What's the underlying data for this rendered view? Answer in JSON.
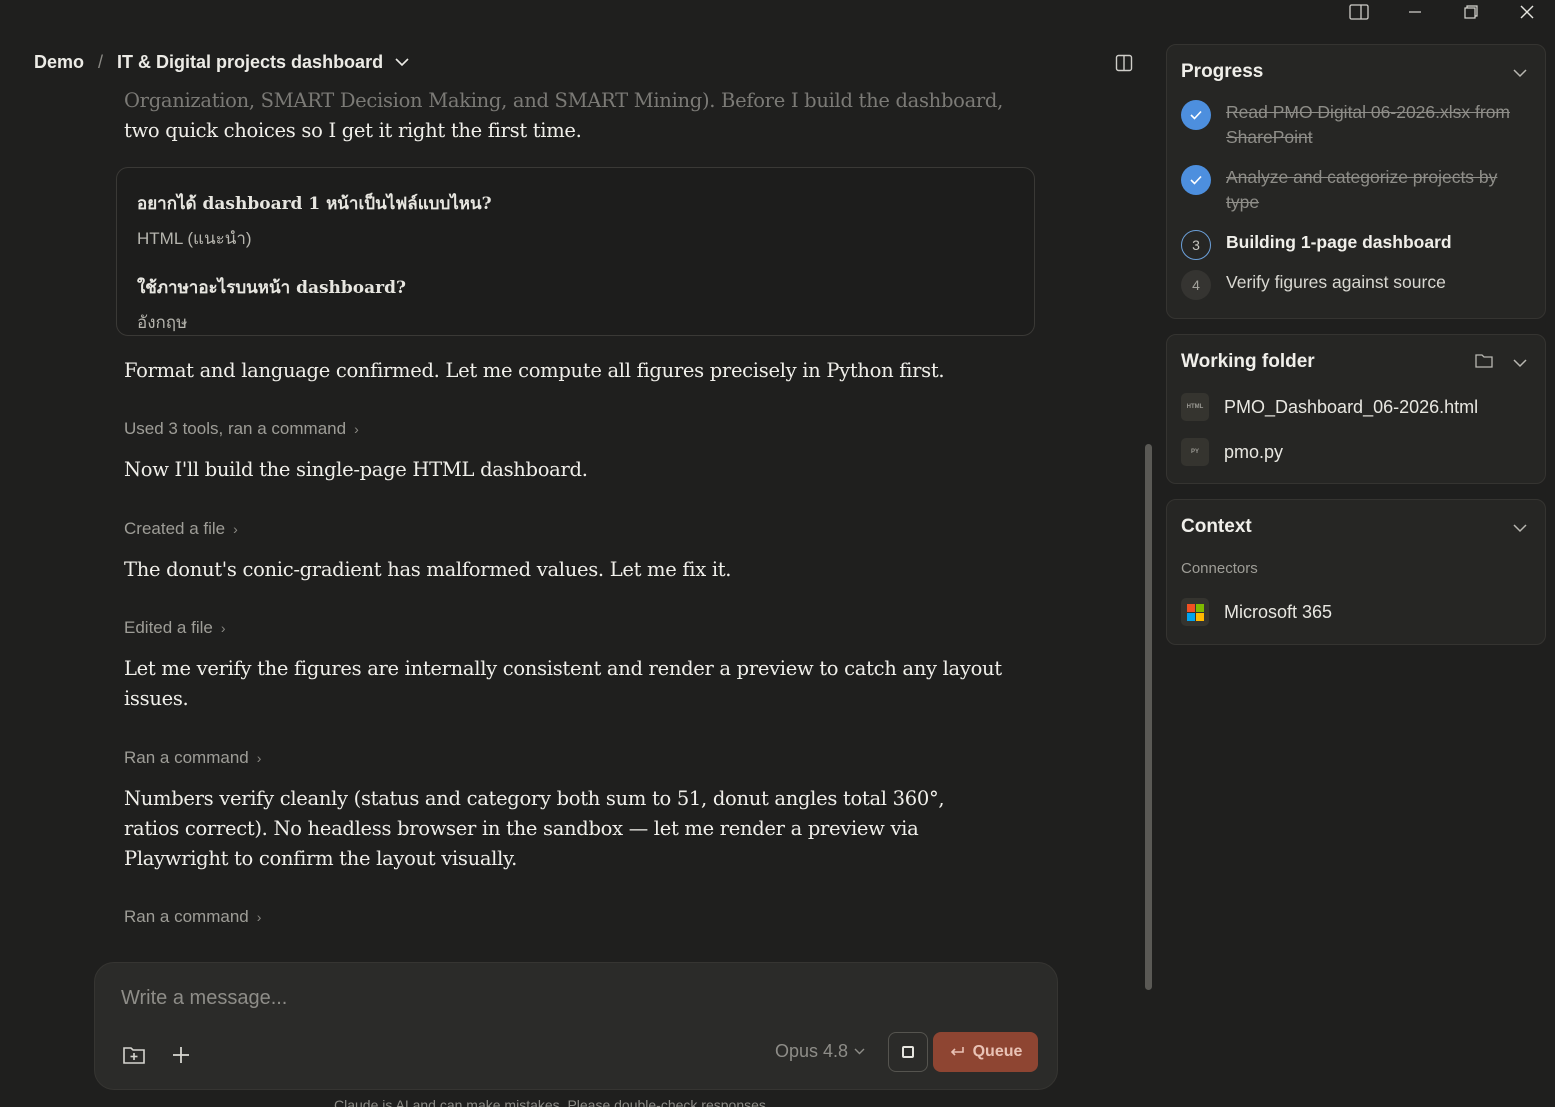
{
  "header": {
    "workspace": "Demo",
    "separator": "/",
    "project_title": "IT & Digital projects dashboard"
  },
  "chat": {
    "faded_line": "Organization, SMART Decision Making, and SMART Mining). Before I build the dashboard,",
    "intro_line": "two quick choices so I get it right the first time.",
    "questions": [
      {
        "question": "อยากได้ dashboard 1 หน้าเป็นไฟล์แบบไหน?",
        "answer": "HTML (แนะนำ)"
      },
      {
        "question": "ใช้ภาษาอะไรบนหน้า dashboard?",
        "answer": "อังกฤษ"
      }
    ],
    "msg_format_confirmed": "Format and language confirmed. Let me compute all figures precisely in Python first.",
    "tool_used_3": "Used 3 tools, ran a command",
    "msg_build": "Now I'll build the single-page HTML dashboard.",
    "tool_created": "Created a file",
    "msg_donut": "The donut's conic-gradient has malformed values. Let me fix it.",
    "tool_edited": "Edited a file",
    "msg_verify": "Let me verify the figures are internally consistent and render a preview to catch any layout issues.",
    "tool_ran_1": "Ran a command",
    "msg_numbers": "Numbers verify cleanly (status and category both sum to 51, donut angles total 360°, ratios correct). No headless browser in the sandbox — let me render a preview via Playwright to confirm the layout visually.",
    "tool_ran_2": "Ran a command"
  },
  "composer": {
    "placeholder": "Write a message...",
    "model": "Opus 4.8",
    "queue_label": "Queue",
    "disclaimer": "Claude is AI and can make mistakes. Please double-check responses."
  },
  "progress": {
    "title": "Progress",
    "steps": [
      {
        "num": "1",
        "label": "Read PMO Digital 06-2026.xlsx from SharePoint",
        "state": "done"
      },
      {
        "num": "2",
        "label": "Analyze and categorize projects by type",
        "state": "done"
      },
      {
        "num": "3",
        "label": "Building 1-page dashboard",
        "state": "active"
      },
      {
        "num": "4",
        "label": "Verify figures against source",
        "state": "todo"
      }
    ]
  },
  "working_folder": {
    "title": "Working folder",
    "files": [
      {
        "name": "PMO_Dashboard_06-2026.html",
        "badge": "HTML"
      },
      {
        "name": "pmo.py",
        "badge": "PY"
      }
    ]
  },
  "context": {
    "title": "Context",
    "section": "Connectors",
    "connector": "Microsoft 365"
  },
  "colors": {
    "accent": "#4d8fde",
    "queue_button": "#8e4532",
    "background": "#1f1f1e"
  }
}
